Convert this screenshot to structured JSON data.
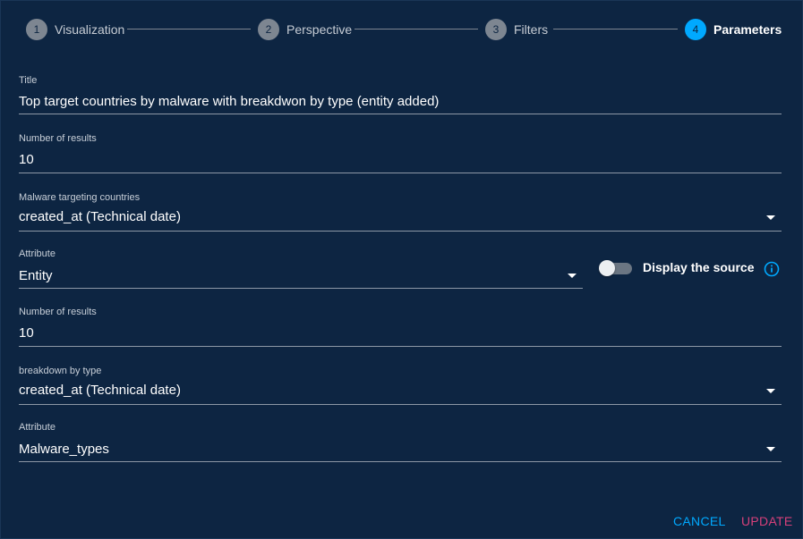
{
  "stepper": {
    "steps": [
      {
        "number": "1",
        "label": "Visualization"
      },
      {
        "number": "2",
        "label": "Perspective"
      },
      {
        "number": "3",
        "label": "Filters"
      },
      {
        "number": "4",
        "label": "Parameters"
      }
    ],
    "active_step": 4,
    "colors": {
      "active": "#00a9ff",
      "inactive": "#7d8691"
    }
  },
  "form": {
    "title": {
      "label": "Title",
      "value": "Top target countries by malware with breakdwon by type (entity added)"
    },
    "number_of_results_1": {
      "label": "Number of results",
      "value": "10"
    },
    "malware_targeting": {
      "label": "Malware targeting countries",
      "value": "created_at (Technical date)"
    },
    "attribute_1": {
      "label": "Attribute",
      "value": "Entity"
    },
    "display_source": {
      "label": "Display the source",
      "checked": false
    },
    "number_of_results_2": {
      "label": "Number of results",
      "value": "10"
    },
    "breakdown": {
      "label": "breakdown by type",
      "value": "created_at (Technical date)"
    },
    "attribute_2": {
      "label": "Attribute",
      "value": "Malware_types"
    }
  },
  "actions": {
    "cancel_label": "CANCEL",
    "update_label": "UPDATE"
  },
  "icons": {
    "select_arrow": "chevron-down-icon",
    "info": "info-icon"
  },
  "theme": {
    "background": "#0d2542",
    "primary": "#00a9ff",
    "secondary": "#d6407a"
  }
}
